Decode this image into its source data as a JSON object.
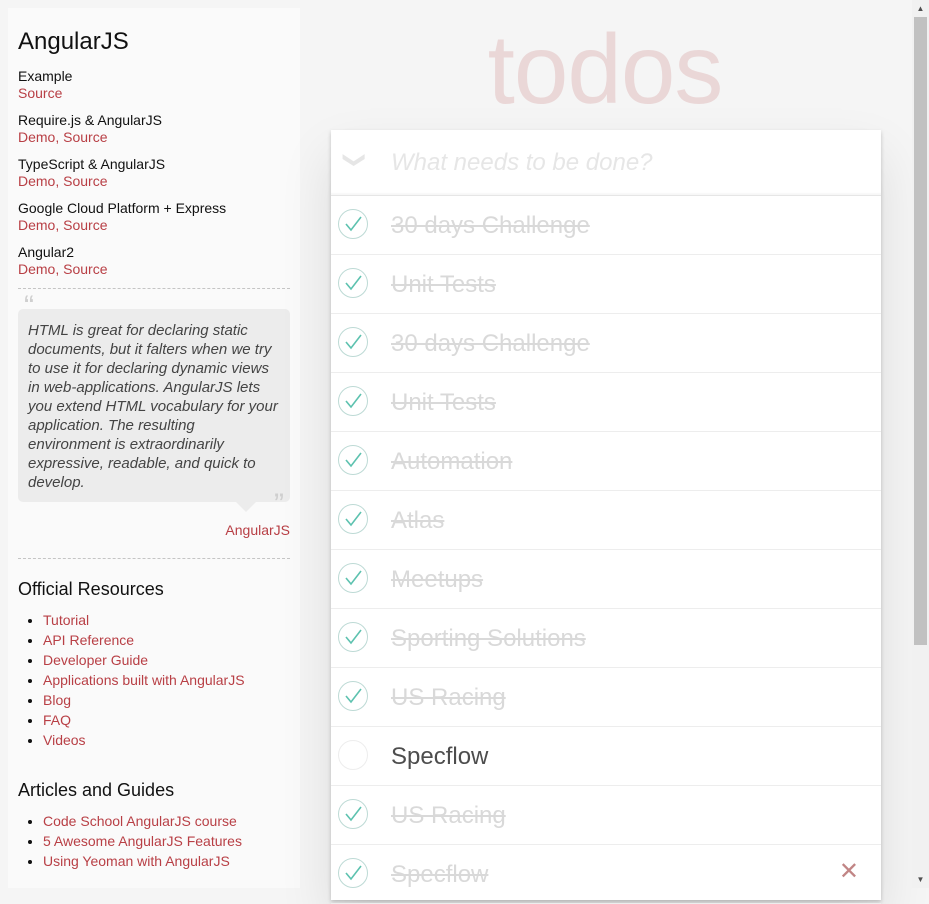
{
  "sidebar": {
    "title": "AngularJS",
    "examples": [
      {
        "name": "Example",
        "links": "Source"
      },
      {
        "name": "Require.js & AngularJS",
        "links": "Demo, Source"
      },
      {
        "name": "TypeScript & AngularJS",
        "links": "Demo, Source"
      },
      {
        "name": "Google Cloud Platform + Express",
        "links": "Demo, Source"
      },
      {
        "name": "Angular2",
        "links": "Demo, Source"
      }
    ],
    "quote": {
      "text": "HTML is great for declaring static documents, but it falters when we try to use it for declaring dynamic views in web-applications. AngularJS lets you extend HTML vocabulary for your application. The resulting environment is extraordinarily expressive, readable, and quick to develop.",
      "open_mark": "“",
      "close_mark": "”",
      "source": "AngularJS"
    },
    "official_resources": {
      "title": "Official Resources",
      "items": [
        "Tutorial",
        "API Reference",
        "Developer Guide",
        "Applications built with AngularJS",
        "Blog",
        "FAQ",
        "Videos"
      ]
    },
    "articles": {
      "title": "Articles and Guides",
      "items": [
        "Code School AngularJS course",
        "5 Awesome AngularJS Features",
        "Using Yeoman with AngularJS"
      ]
    }
  },
  "app": {
    "title": "todos",
    "toggle_all_glyph": "❯",
    "new_todo_placeholder": "What needs to be done?",
    "todos": [
      {
        "text": "30 days Challenge",
        "completed": true
      },
      {
        "text": "Unit Tests",
        "completed": true
      },
      {
        "text": "30 days Challenge",
        "completed": true
      },
      {
        "text": "Unit Tests",
        "completed": true
      },
      {
        "text": "Automation",
        "completed": true
      },
      {
        "text": "Atlas",
        "completed": true
      },
      {
        "text": "Meetups",
        "completed": true
      },
      {
        "text": "Sporting Solutions",
        "completed": true
      },
      {
        "text": "US Racing",
        "completed": true
      },
      {
        "text": "Specflow",
        "completed": false
      },
      {
        "text": "US Racing",
        "completed": true
      },
      {
        "text": "Specflow",
        "completed": true
      }
    ],
    "destroy_glyph": "✕"
  },
  "scrollbar": {
    "up_glyph": "▲",
    "down_glyph": "▼"
  },
  "colors": {
    "accent": "#b83f45",
    "check": "#5dc2af",
    "title": "rgba(175,47,47,0.15)"
  }
}
